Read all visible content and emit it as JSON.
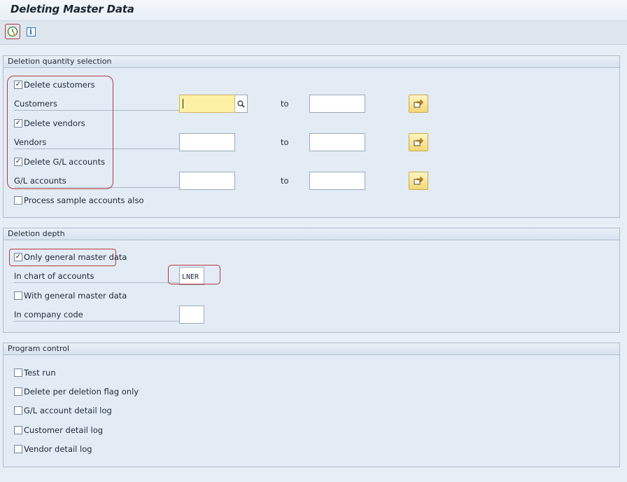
{
  "window": {
    "title": "Deleting Master Data"
  },
  "toolbar": {
    "execute_icon": "execute-clock-icon",
    "info_icon": "info-icon"
  },
  "deletion_quantity": {
    "header": "Deletion quantity selection",
    "delete_customers": {
      "label": "Delete customers",
      "checked": true
    },
    "customers": {
      "label": "Customers",
      "from": "",
      "to_label": "to",
      "to": ""
    },
    "delete_vendors": {
      "label": "Delete vendors",
      "checked": true
    },
    "vendors": {
      "label": "Vendors",
      "from": "",
      "to_label": "to",
      "to": ""
    },
    "delete_gl": {
      "label": "Delete G/L accounts",
      "checked": true
    },
    "gl_accounts": {
      "label": "G/L accounts",
      "from": "",
      "to_label": "to",
      "to": ""
    },
    "process_sample": {
      "label": "Process sample accounts also",
      "checked": false
    }
  },
  "deletion_depth": {
    "header": "Deletion depth",
    "only_general": {
      "label": "Only general master data",
      "checked": true
    },
    "chart_of_accounts": {
      "label": "In chart of accounts",
      "value": "LNER"
    },
    "with_general": {
      "label": "With general master data",
      "checked": false
    },
    "company_code": {
      "label": "In company code",
      "value": ""
    }
  },
  "program_control": {
    "header": "Program control",
    "test_run": {
      "label": "Test run",
      "checked": false
    },
    "delete_flag_only": {
      "label": "Delete per deletion flag only",
      "checked": false
    },
    "gl_detail_log": {
      "label": "G/L account detail log",
      "checked": false
    },
    "customer_detail_log": {
      "label": "Customer detail log",
      "checked": false
    },
    "vendor_detail_log": {
      "label": "Vendor detail log",
      "checked": false
    }
  },
  "colors": {
    "highlight": "#b23a3a",
    "focus_field": "#fdf1a6",
    "group_bg": "#e3ecf5"
  }
}
